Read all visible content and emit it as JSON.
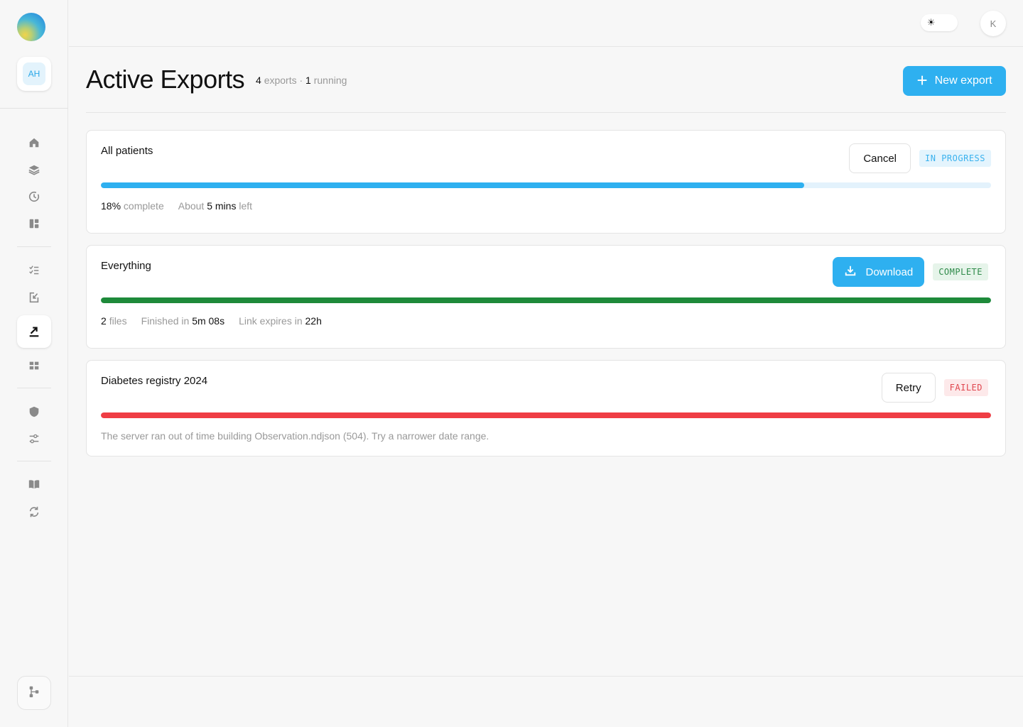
{
  "workspace": {
    "initials": "AH"
  },
  "user": {
    "initial": "K"
  },
  "theme": {
    "light_icon": "sun-icon",
    "dark_icon": "moon-icon"
  },
  "sidebar": {
    "groups": [
      [
        "home-icon",
        "layers-icon",
        "history-icon",
        "dashboard-icon"
      ],
      [
        "checklist-icon",
        "import-icon",
        "export-icon",
        "grid-icon"
      ],
      [
        "shield-icon",
        "sliders-icon"
      ],
      [
        "book-icon",
        "sync-icon"
      ]
    ],
    "active": "export-icon",
    "bottom_icon": "hierarchy-icon"
  },
  "page": {
    "title": "Active Exports",
    "export_count": "4",
    "exports_label": "exports ·",
    "running_count": "1",
    "running_label": "running",
    "new_export_label": "New export"
  },
  "exports": [
    {
      "name": "All patients",
      "action": "Cancel",
      "status": "IN PROGRESS",
      "progress_fraction": 0.79,
      "pct": "18%",
      "pct_label": "complete",
      "eta_prefix": "About",
      "eta_value": "5 mins",
      "eta_suffix": "left"
    },
    {
      "name": "Everything",
      "action": "Download",
      "status": "COMPLETE",
      "progress_fraction": 1.0,
      "files_count": "2",
      "files_label": "files",
      "finished_label": "Finished in",
      "finished_value": "5m 08s",
      "expires_label": "Link expires in",
      "expires_value": "22h"
    },
    {
      "name": "Diabetes registry 2024",
      "action": "Retry",
      "status": "FAILED",
      "progress_fraction": 1.0,
      "error": "The server ran out of time building Observation.ndjson (504). Try a narrower date range."
    }
  ],
  "colors": {
    "accent": "#2eb0f0",
    "progress": "#2eb0f0",
    "success": "#1e8a3a",
    "error": "#ef3d44",
    "track": "#e3f2fc"
  }
}
